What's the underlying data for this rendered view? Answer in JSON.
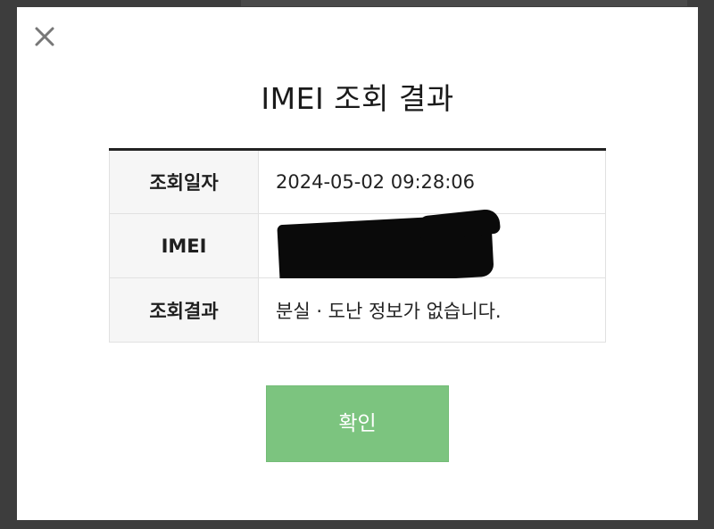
{
  "dialog": {
    "title": "IMEI 조회 결과",
    "close_icon": "close-icon",
    "rows": [
      {
        "label": "조회일자",
        "value": "2024-05-02 09:28:06"
      },
      {
        "label": "IMEI",
        "value": ""
      },
      {
        "label": "조회결과",
        "value": "분실 · 도난 정보가 없습니다."
      }
    ],
    "confirm_label": "확인"
  },
  "colors": {
    "confirm_button": "#7cc47f",
    "table_top_border": "#222222",
    "header_cell_bg": "#f6f6f6"
  }
}
